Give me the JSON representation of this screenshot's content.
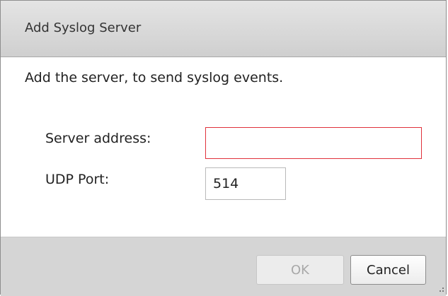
{
  "dialog": {
    "title": "Add Syslog Server",
    "description": "Add the server, to send syslog events."
  },
  "form": {
    "server_address": {
      "label": "Server address:",
      "value": "",
      "placeholder": ""
    },
    "udp_port": {
      "label": "UDP Port:",
      "value": "514",
      "placeholder": ""
    }
  },
  "footer": {
    "ok_label": "OK",
    "cancel_label": "Cancel"
  },
  "colors": {
    "error_border": "#e0313b",
    "title_bar": "#d8d8d8",
    "footer_bg": "#d5d5d5"
  },
  "icons": {
    "resize_grip": "resize-grip-icon"
  }
}
